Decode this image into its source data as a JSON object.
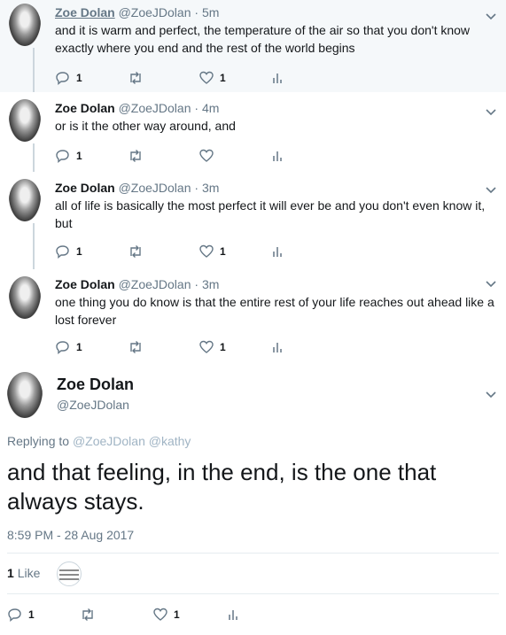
{
  "tweets": [
    {
      "name": "Zoe Dolan",
      "handle": "@ZoeJDolan",
      "dot": "·",
      "time": "5m",
      "text": "and it is warm and perfect, the temperature of the air so that you don't know exactly where you end and the rest of the world begins",
      "reply_count": "1",
      "like_count": "1"
    },
    {
      "name": "Zoe Dolan",
      "handle": "@ZoeJDolan",
      "dot": "·",
      "time": "4m",
      "text": "or is it the other way around, and",
      "reply_count": "1",
      "like_count": ""
    },
    {
      "name": "Zoe Dolan",
      "handle": "@ZoeJDolan",
      "dot": "·",
      "time": "3m",
      "text": "all of life is basically the most perfect it will ever be and you don't even know it, but",
      "reply_count": "1",
      "like_count": "1"
    },
    {
      "name": "Zoe Dolan",
      "handle": "@ZoeJDolan",
      "dot": "·",
      "time": "3m",
      "text": "one thing you do know is that the entire rest of your life reaches out ahead like a lost forever",
      "reply_count": "1",
      "like_count": "1"
    }
  ],
  "main": {
    "name": "Zoe Dolan",
    "handle": "@ZoeJDolan",
    "replying_prefix": "Replying to",
    "replying_to_1": "@ZoeJDolan",
    "replying_to_2": "@kathy",
    "text": "and that feeling, in the end, is the one that always stays.",
    "datetime": "8:59 PM - 28 Aug 2017",
    "likes_count": "1",
    "likes_label": "Like",
    "reply_count": "1",
    "like_count": "1"
  },
  "icons": {
    "reply": "reply-icon",
    "retweet": "retweet-icon",
    "like": "heart-icon",
    "analytics": "analytics-icon",
    "more": "chevron-down-icon"
  },
  "colors": {
    "muted": "#657786",
    "highlight_bg": "#f5f8fa",
    "divider": "#e6ecf0"
  }
}
